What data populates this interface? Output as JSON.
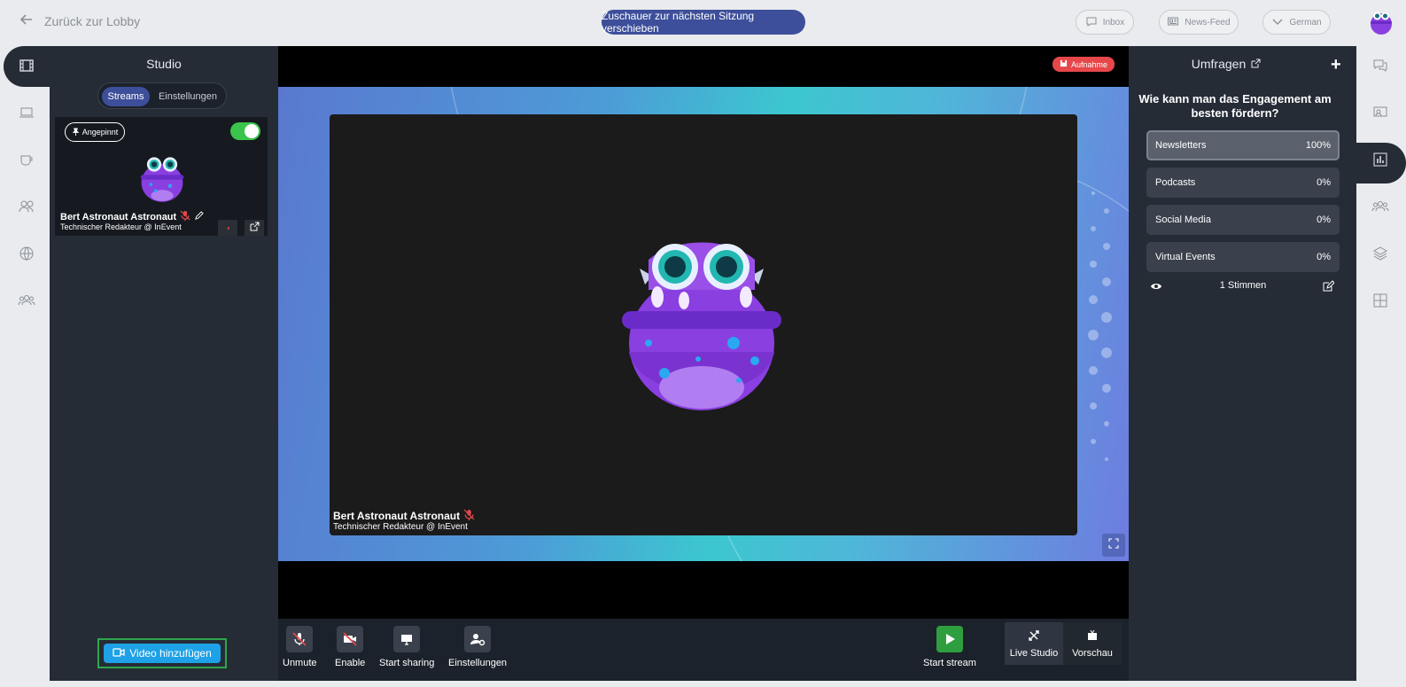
{
  "topbar": {
    "back_label": "Zurück zur Lobby",
    "move_viewers_label": "Zuschauer zur nächsten Sitzung verschieben",
    "inbox_label": "Inbox",
    "newsfeed_label": "News-Feed",
    "language_label": "German"
  },
  "studio": {
    "title": "Studio",
    "tabs": {
      "streams": "Streams",
      "settings": "Einstellungen"
    },
    "card": {
      "pinned_label": "Angepinnt",
      "name": "Bert Astronaut Astronaut",
      "role": "Technischer Redakteur @ InEvent",
      "visible": true
    },
    "add_video_label": "Video hinzufügen"
  },
  "stage": {
    "record_label": "Aufnahme",
    "speaker_name": "Bert Astronaut Astronaut",
    "speaker_role": "Technischer Redakteur @ InEvent"
  },
  "toolbar": {
    "unmute_label": "Unmute",
    "enable_label": "Enable",
    "share_label": "Start sharing",
    "settings_label": "Einstellungen",
    "start_stream_label": "Start stream",
    "live_studio_label": "Live Studio",
    "preview_label": "Vorschau"
  },
  "polls": {
    "title": "Umfragen",
    "question": "Wie kann man das Engagement am besten fördern?",
    "options": [
      {
        "label": "Newsletters",
        "percent": "100%"
      },
      {
        "label": "Podcasts",
        "percent": "0%"
      },
      {
        "label": "Social Media",
        "percent": "0%"
      },
      {
        "label": "Virtual Events",
        "percent": "0%"
      }
    ],
    "votes_label": "1 Stimmen"
  },
  "colors": {
    "accent": "#3d4f9a",
    "panel": "#252c36",
    "record": "#e6474a",
    "add_video": "#1ea1e6",
    "toggle_on": "#3bc44b",
    "stream_green": "#2e9e3e"
  }
}
